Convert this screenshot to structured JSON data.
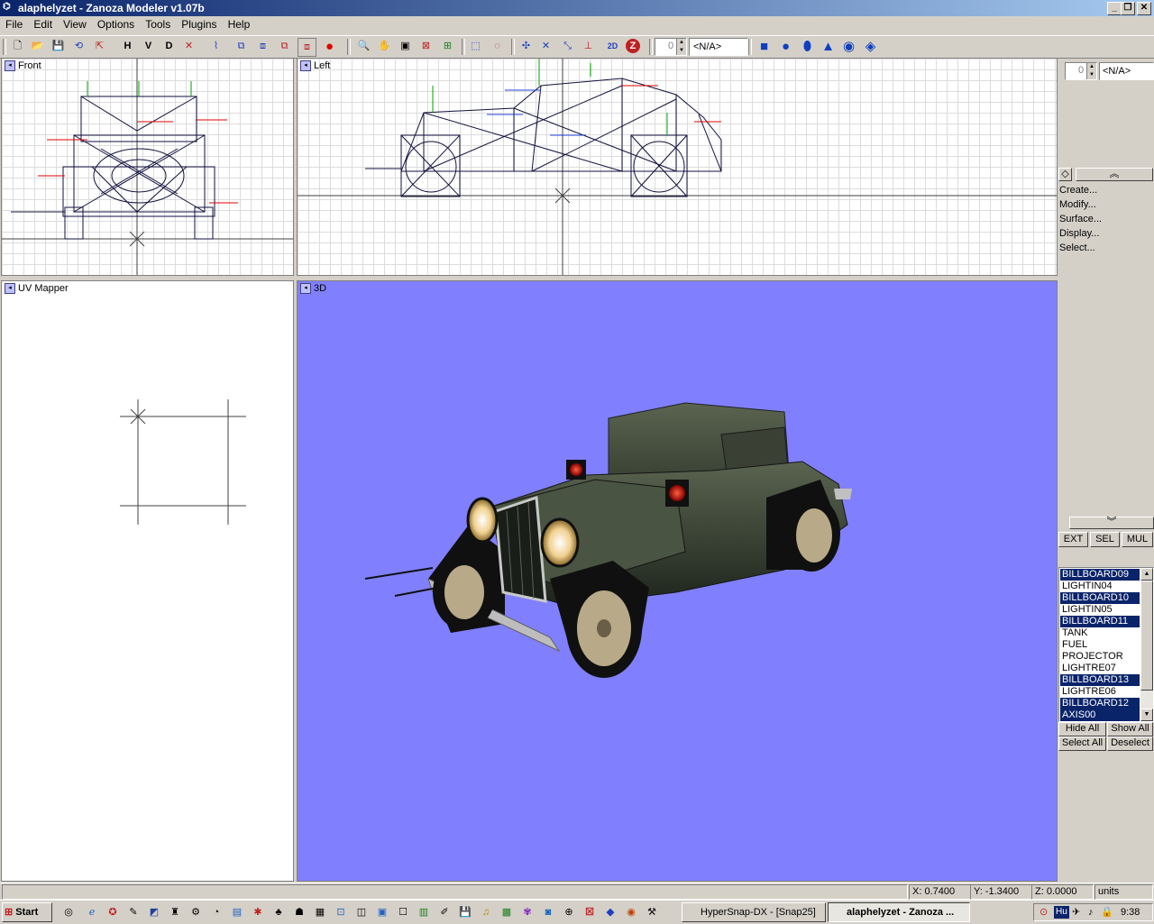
{
  "window": {
    "title": "alaphelyzet - Zanoza Modeler v1.07b",
    "minimize": "_",
    "restore": "❐",
    "close": "✕"
  },
  "menu": [
    "File",
    "Edit",
    "View",
    "Options",
    "Tools",
    "Plugins",
    "Help"
  ],
  "toolbar": {
    "view_h": "H",
    "view_v": "V",
    "view_d": "D",
    "frame_value": "0",
    "frame_name": "<N/A>",
    "mode_2d": "2D",
    "mode_z": "Z"
  },
  "viewports": {
    "front": "Front",
    "left": "Left",
    "uv": "UV Mapper",
    "three_d": "3D"
  },
  "colors": {
    "viewport_3d_bg": "#8080ff",
    "selection": "#0a246a",
    "titlebar": "#0a246a"
  },
  "panel": {
    "frame_value": "0",
    "frame_name": "<N/A>",
    "commands": [
      "Create...",
      "Modify...",
      "Surface...",
      "Display...",
      "Select..."
    ],
    "ext": "EXT",
    "sel": "SEL",
    "mul": "MUL",
    "objects": [
      {
        "name": "BILLBOARD09",
        "selected": true
      },
      {
        "name": "LIGHTIN04",
        "selected": false
      },
      {
        "name": "BILLBOARD10",
        "selected": true
      },
      {
        "name": "LIGHTIN05",
        "selected": false
      },
      {
        "name": "BILLBOARD11",
        "selected": true
      },
      {
        "name": "TANK",
        "selected": false
      },
      {
        "name": "FUEL",
        "selected": false
      },
      {
        "name": "PROJECTOR",
        "selected": false
      },
      {
        "name": "LIGHTRE07",
        "selected": false
      },
      {
        "name": "BILLBOARD13",
        "selected": true
      },
      {
        "name": "LIGHTRE06",
        "selected": false
      },
      {
        "name": "BILLBOARD12",
        "selected": true
      },
      {
        "name": "AXIS00",
        "selected": true
      }
    ],
    "hide_all": "Hide All",
    "show_all": "Show All",
    "select_all": "Select All",
    "deselect": "Deselect"
  },
  "status": {
    "x": "X: 0.7400",
    "y": "Y: -1.3400",
    "z": "Z: 0.0000",
    "units": "units"
  },
  "taskbar": {
    "start": "Start",
    "tasks": [
      {
        "label": "HyperSnap-DX - [Snap25]",
        "active": false
      },
      {
        "label": "alaphelyzet - Zanoza ...",
        "active": true
      }
    ],
    "lang": "Hu",
    "clock": "9:38"
  }
}
